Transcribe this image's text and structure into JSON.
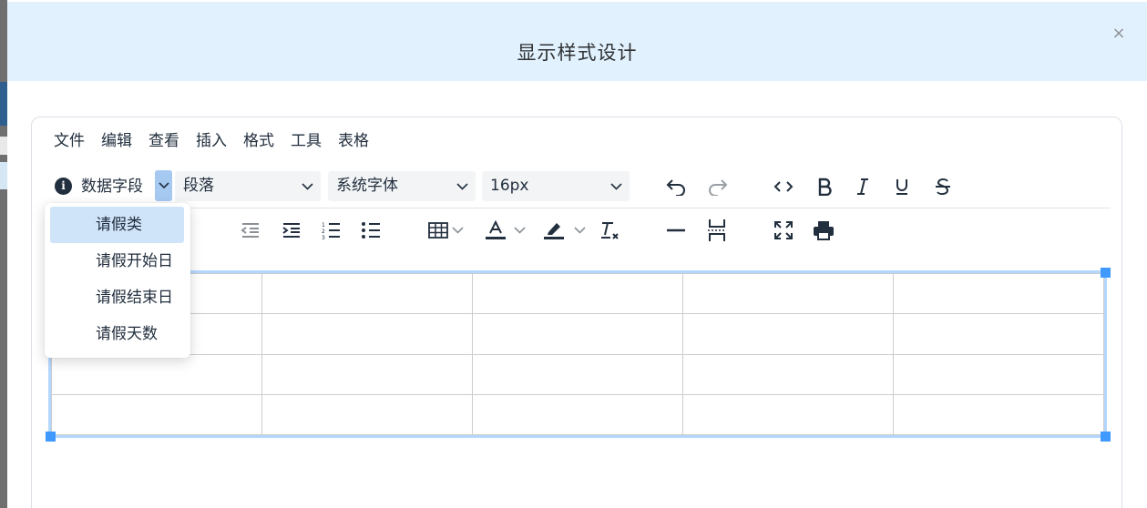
{
  "dialog": {
    "title": "显示样式设计",
    "close_glyph": "×"
  },
  "menubar": [
    "文件",
    "编辑",
    "查看",
    "插入",
    "格式",
    "工具",
    "表格"
  ],
  "toolbar": {
    "datafield_label": "数据字段",
    "block_format": "段落",
    "font_family": "系统字体",
    "font_size": "16px"
  },
  "dropdown": {
    "items": [
      "请假类",
      "请假开始日",
      "请假结束日",
      "请假天数"
    ],
    "highlighted": "请假类"
  },
  "table": {
    "rows": 4,
    "cols": 5
  },
  "icons": {
    "toolbar1": [
      "info-icon",
      "chevron-down-icon",
      "undo-icon",
      "redo-icon",
      "source-code-icon",
      "bold-icon",
      "italic-icon",
      "underline-icon",
      "strikethrough-icon"
    ],
    "toolbar2": [
      "outdent-icon",
      "indent-icon",
      "numbered-list-icon",
      "bullet-list-icon",
      "table-icon",
      "text-color-icon",
      "highlight-color-icon",
      "clear-format-icon",
      "horizontal-rule-icon",
      "page-break-icon",
      "fullscreen-icon",
      "print-icon"
    ]
  },
  "colors": {
    "header_bg": "#e1f2fe",
    "accent": "#4099ff",
    "selection_border": "#b4d7ff",
    "menu_highlight": "#cfe3f9"
  }
}
